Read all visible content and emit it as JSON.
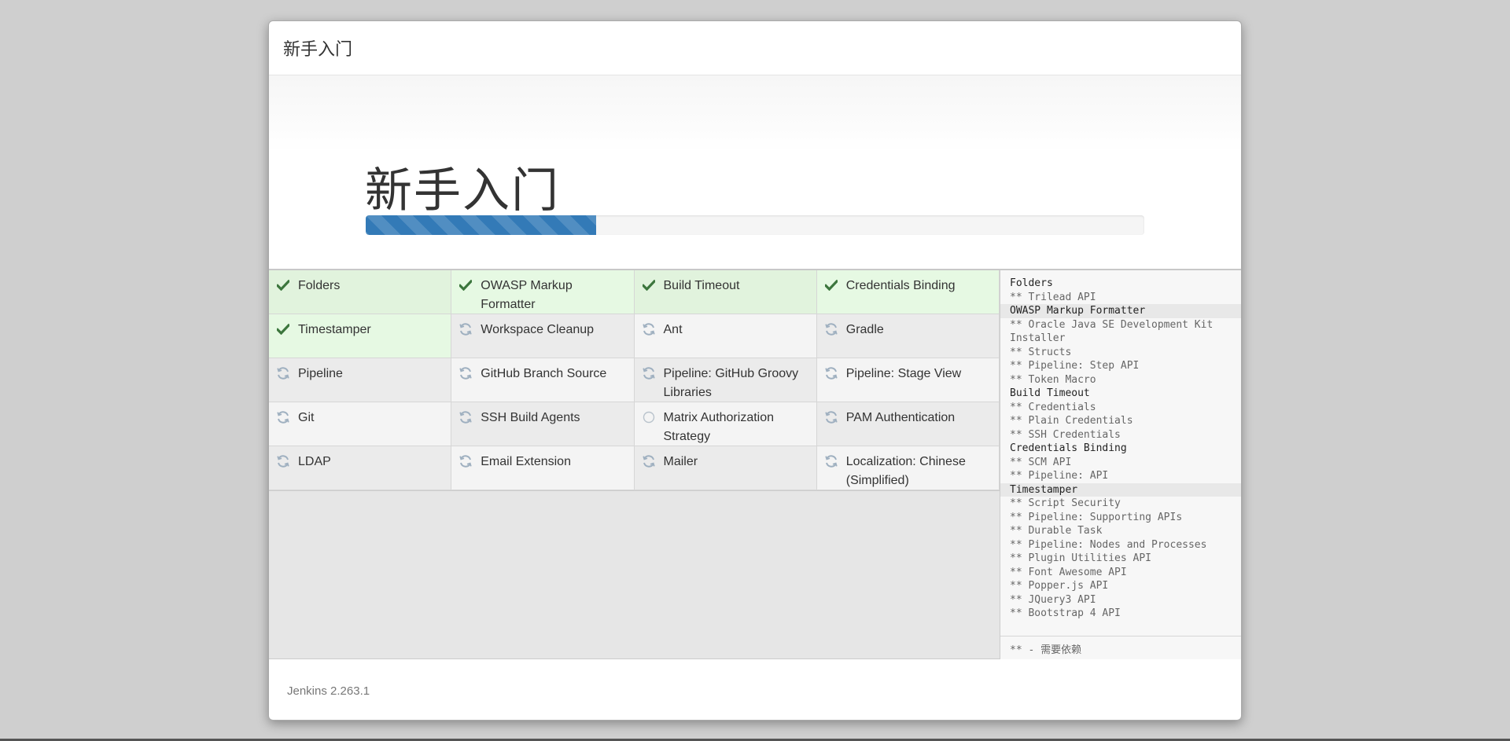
{
  "header": {
    "title": "新手入门"
  },
  "jumbotron": {
    "heading": "新手入门",
    "progress_percent": 29.6
  },
  "plugins": [
    {
      "label": "Folders",
      "status": "success",
      "icon": "check-icon"
    },
    {
      "label": "OWASP Markup Formatter",
      "status": "success",
      "icon": "check-icon"
    },
    {
      "label": "Build Timeout",
      "status": "success",
      "icon": "check-icon"
    },
    {
      "label": "Credentials Binding",
      "status": "success",
      "icon": "check-icon"
    },
    {
      "label": "Timestamper",
      "status": "success",
      "icon": "check-icon"
    },
    {
      "label": "Workspace Cleanup",
      "status": "pending",
      "icon": "refresh-icon"
    },
    {
      "label": "Ant",
      "status": "pending",
      "icon": "refresh-icon"
    },
    {
      "label": "Gradle",
      "status": "pending",
      "icon": "refresh-icon"
    },
    {
      "label": "Pipeline",
      "status": "pending",
      "icon": "refresh-icon"
    },
    {
      "label": "GitHub Branch Source",
      "status": "pending",
      "icon": "refresh-icon"
    },
    {
      "label": "Pipeline: GitHub Groovy Libraries",
      "status": "pending",
      "icon": "refresh-icon"
    },
    {
      "label": "Pipeline: Stage View",
      "status": "pending",
      "icon": "refresh-icon"
    },
    {
      "label": "Git",
      "status": "pending",
      "icon": "refresh-icon"
    },
    {
      "label": "SSH Build Agents",
      "status": "pending",
      "icon": "refresh-icon"
    },
    {
      "label": "Matrix Authorization Strategy",
      "status": "pending",
      "icon": "circle-icon"
    },
    {
      "label": "PAM Authentication",
      "status": "pending",
      "icon": "refresh-icon"
    },
    {
      "label": "LDAP",
      "status": "pending",
      "icon": "refresh-icon"
    },
    {
      "label": "Email Extension",
      "status": "pending",
      "icon": "refresh-icon"
    },
    {
      "label": "Mailer",
      "status": "pending",
      "icon": "refresh-icon"
    },
    {
      "label": "Localization: Chinese (Simplified)",
      "status": "pending",
      "icon": "refresh-icon"
    }
  ],
  "install_log": [
    {
      "text": "Folders",
      "kind": "top"
    },
    {
      "text": "** Trilead API",
      "kind": "dep"
    },
    {
      "text": "OWASP Markup Formatter",
      "kind": "top-hl"
    },
    {
      "text": "** Oracle Java SE Development Kit Installer",
      "kind": "dep"
    },
    {
      "text": "** Structs",
      "kind": "dep"
    },
    {
      "text": "** Pipeline: Step API",
      "kind": "dep"
    },
    {
      "text": "** Token Macro",
      "kind": "dep"
    },
    {
      "text": "Build Timeout",
      "kind": "top"
    },
    {
      "text": "** Credentials",
      "kind": "dep"
    },
    {
      "text": "** Plain Credentials",
      "kind": "dep"
    },
    {
      "text": "** SSH Credentials",
      "kind": "dep"
    },
    {
      "text": "Credentials Binding",
      "kind": "top"
    },
    {
      "text": "** SCM API",
      "kind": "dep"
    },
    {
      "text": "** Pipeline: API",
      "kind": "dep"
    },
    {
      "text": "Timestamper",
      "kind": "top-hl"
    },
    {
      "text": "** Script Security",
      "kind": "dep"
    },
    {
      "text": "** Pipeline: Supporting APIs",
      "kind": "dep"
    },
    {
      "text": "** Durable Task",
      "kind": "dep"
    },
    {
      "text": "** Pipeline: Nodes and Processes",
      "kind": "dep"
    },
    {
      "text": "** Plugin Utilities API",
      "kind": "dep"
    },
    {
      "text": "** Font Awesome API",
      "kind": "dep"
    },
    {
      "text": "** Popper.js API",
      "kind": "dep"
    },
    {
      "text": "** JQuery3 API",
      "kind": "dep"
    },
    {
      "text": "** Bootstrap 4 API",
      "kind": "dep"
    }
  ],
  "install_log_footer": "** - 需要依赖",
  "footer": {
    "version": "Jenkins 2.263.1"
  },
  "colors": {
    "accent": "#337ab7",
    "success_icon": "#3c763d",
    "pending_icon": "#9fb0c0"
  }
}
